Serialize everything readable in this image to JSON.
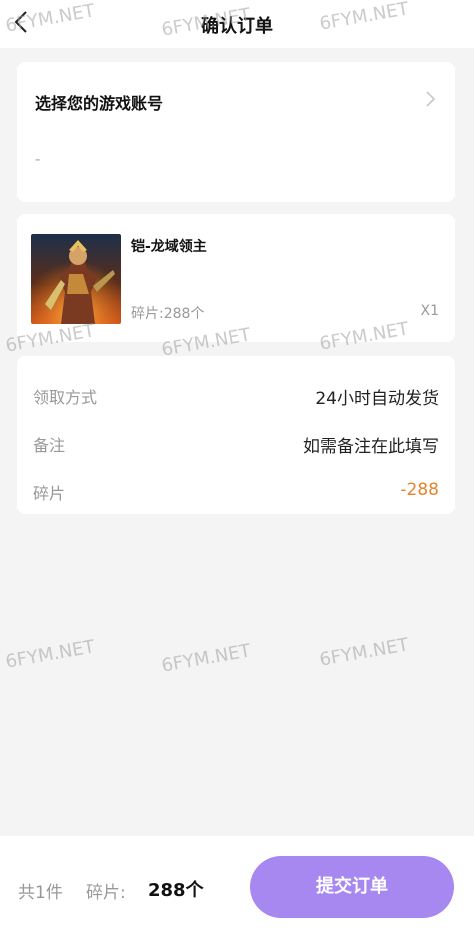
{
  "header": {
    "title": "确认订单"
  },
  "account": {
    "title": "选择您的游戏账号",
    "value": "-"
  },
  "product": {
    "name": "铠-龙域领主",
    "price": "碎片:288个",
    "quantity": "X1"
  },
  "info": {
    "rows": [
      {
        "label": "领取方式",
        "value": "24小时自动发货"
      },
      {
        "label": "备注",
        "value": "如需备注在此填写"
      },
      {
        "label": "碎片",
        "value": "-288"
      }
    ]
  },
  "bottom": {
    "count": "共1件",
    "label": "碎片:",
    "amount": "288个",
    "submit": "提交订单"
  },
  "watermark": "6FYM.NET",
  "colors": {
    "accent": "#a688f0",
    "negative": "#e8832a"
  },
  "icons": [
    "back-arrow-icon",
    "chevron-right-icon"
  ]
}
